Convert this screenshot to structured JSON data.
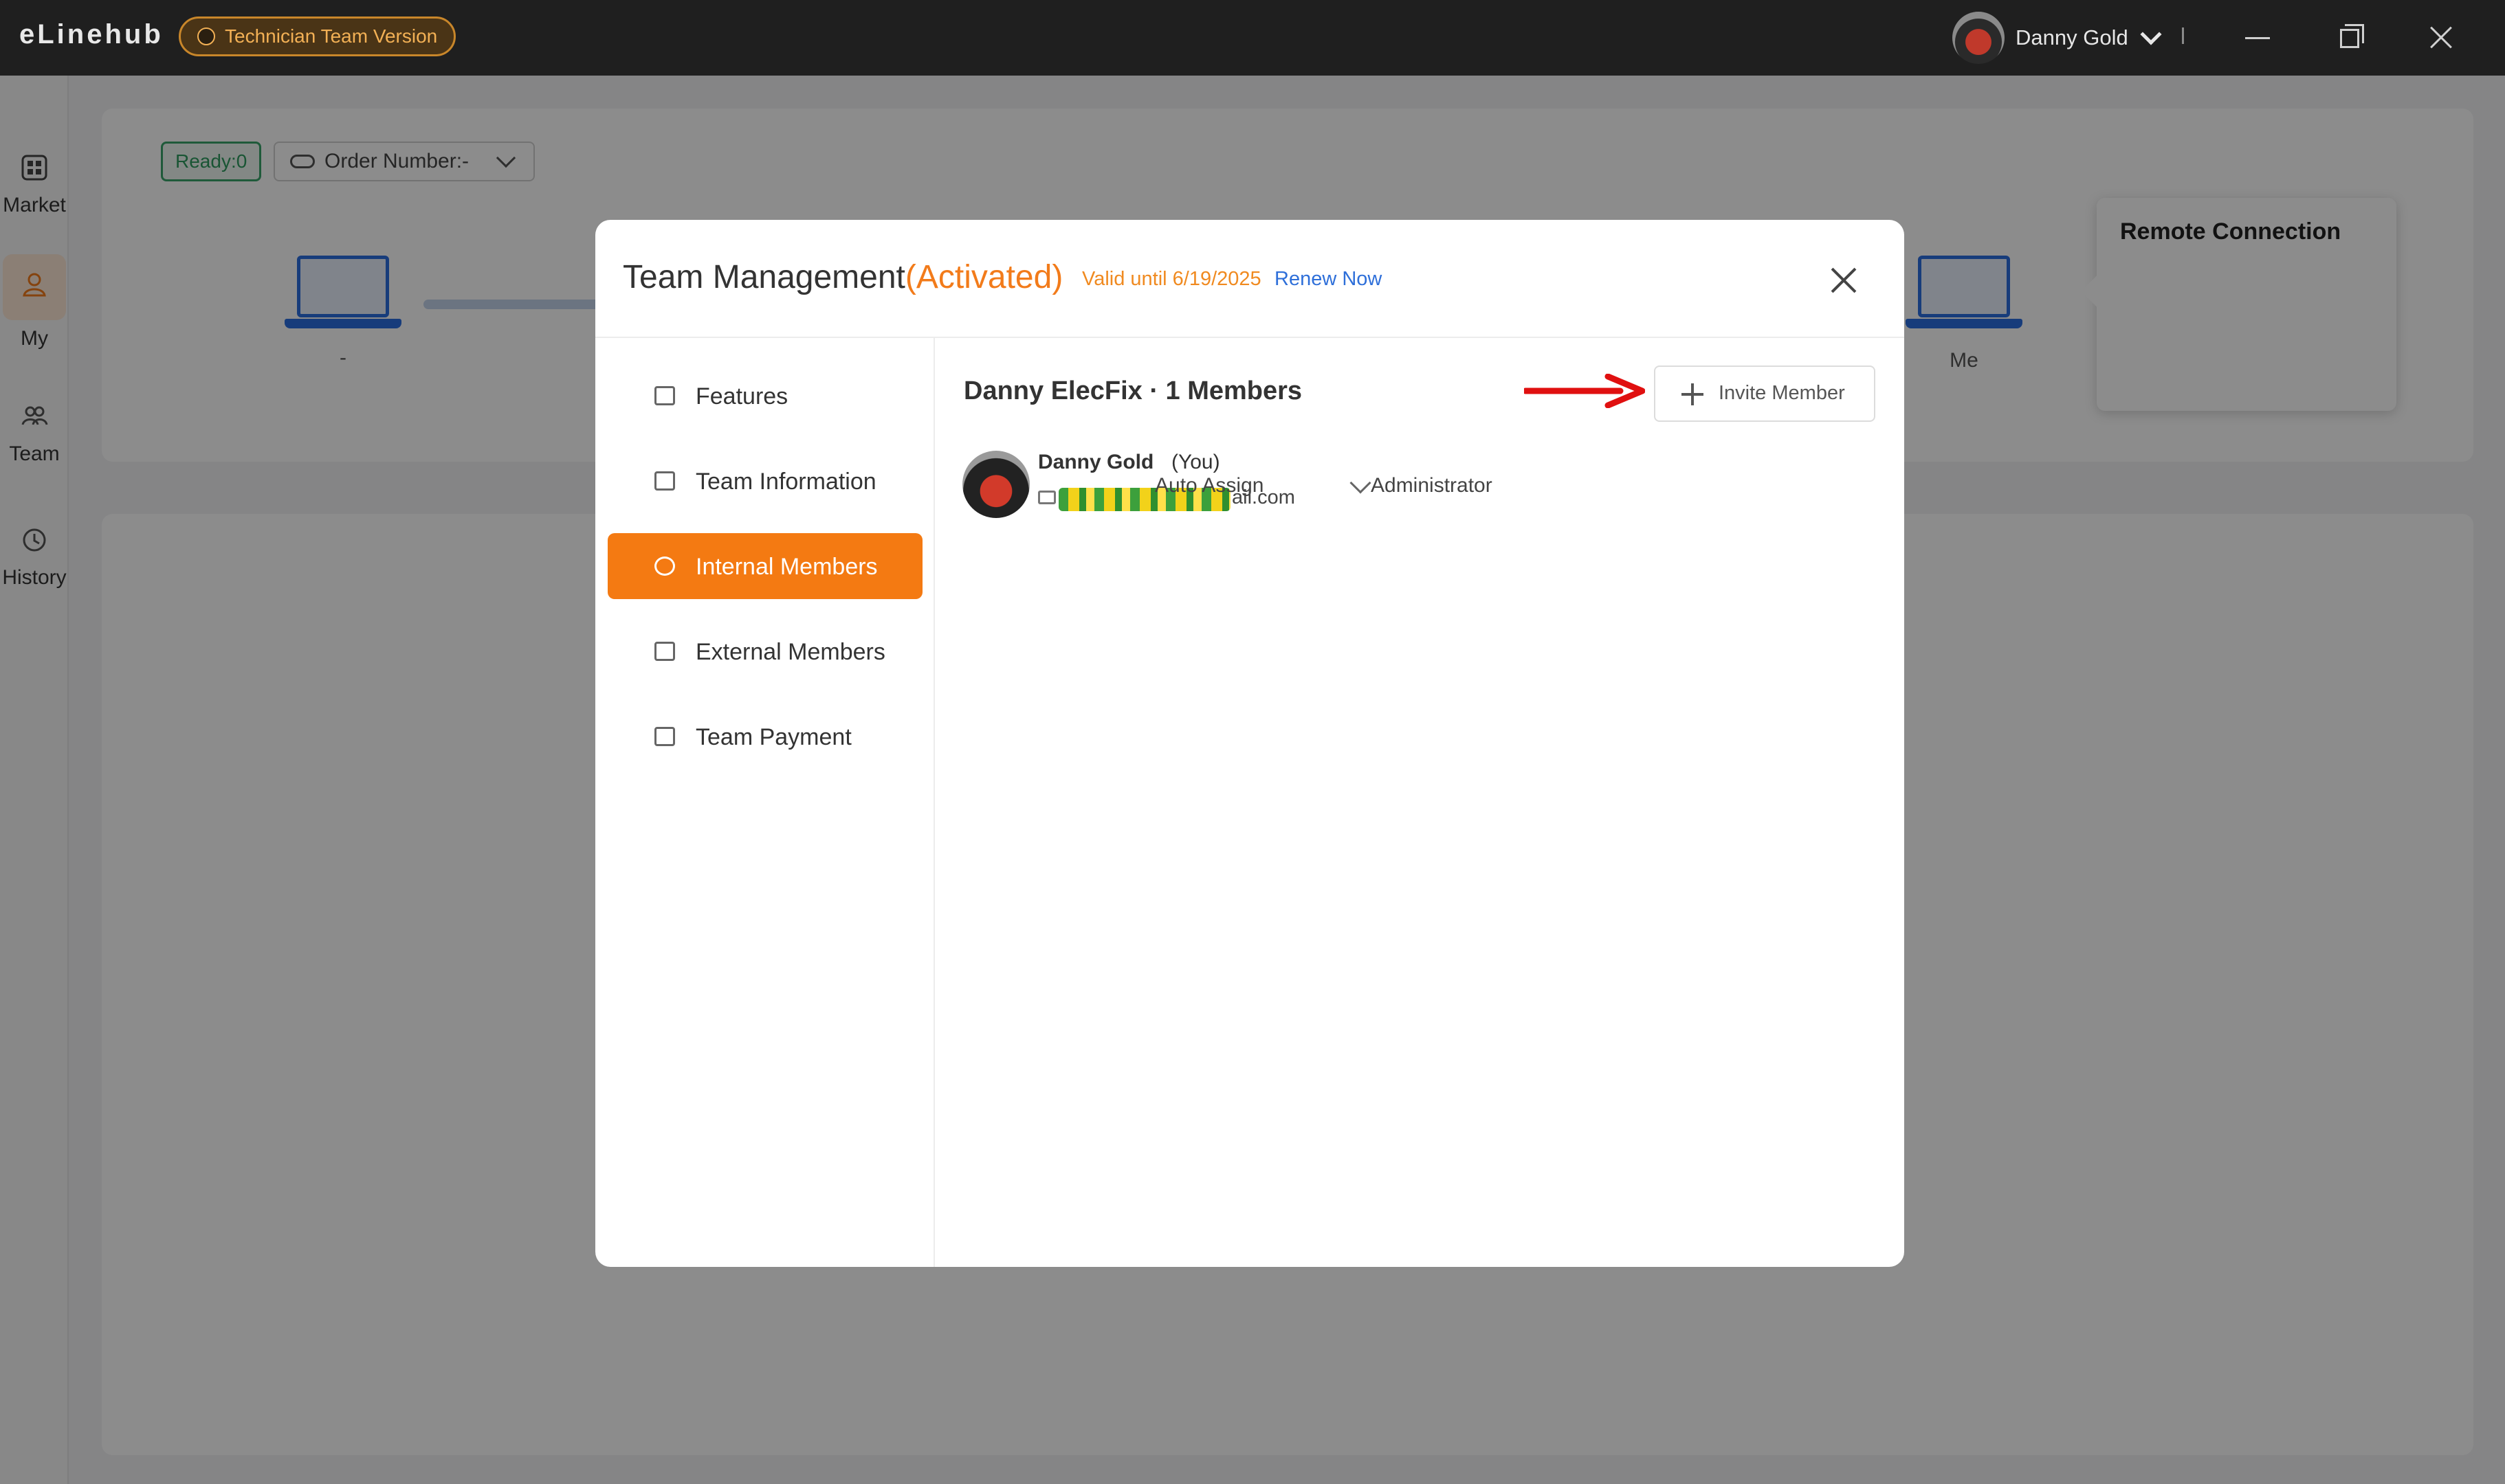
{
  "app": {
    "brand": "eLinehub",
    "version_badge": "Technician Team Version",
    "user_name": "Danny Gold"
  },
  "leftnav": {
    "items": [
      {
        "label": "Market",
        "icon": "grid-icon"
      },
      {
        "label": "My",
        "icon": "user-icon"
      },
      {
        "label": "Team",
        "icon": "team-icon"
      },
      {
        "label": "History",
        "icon": "history-icon"
      }
    ]
  },
  "dashboard": {
    "ready": "Ready:0",
    "order_number": "Order Number:-",
    "left_device_label": "-",
    "right_device_label": "Me",
    "remote_title": "Remote Connection"
  },
  "modal": {
    "title": "Team Management",
    "status": "(Activated)",
    "valid_until": "Valid until 6/19/2025",
    "renew": "Renew Now",
    "sidebar": [
      {
        "label": "Features",
        "icon": "archive-icon"
      },
      {
        "label": "Team Information",
        "icon": "id-card-icon"
      },
      {
        "label": "Internal Members",
        "icon": "person-circle-icon"
      },
      {
        "label": "External Members",
        "icon": "person-cloud-icon"
      },
      {
        "label": "Team Payment",
        "icon": "card-icon"
      }
    ],
    "team_header": "Danny ElecFix · 1 Members",
    "invite_label": "Invite Member",
    "member": {
      "name": "Danny Gold",
      "you": "(You)",
      "email_suffix": "ail.com",
      "assign": "Auto Assign",
      "role": "Administrator"
    }
  },
  "colors": {
    "accent": "#f47a12",
    "link": "#2e6fd9",
    "ready_green": "#3aa56b",
    "titlebar": "#1f1f1f"
  }
}
